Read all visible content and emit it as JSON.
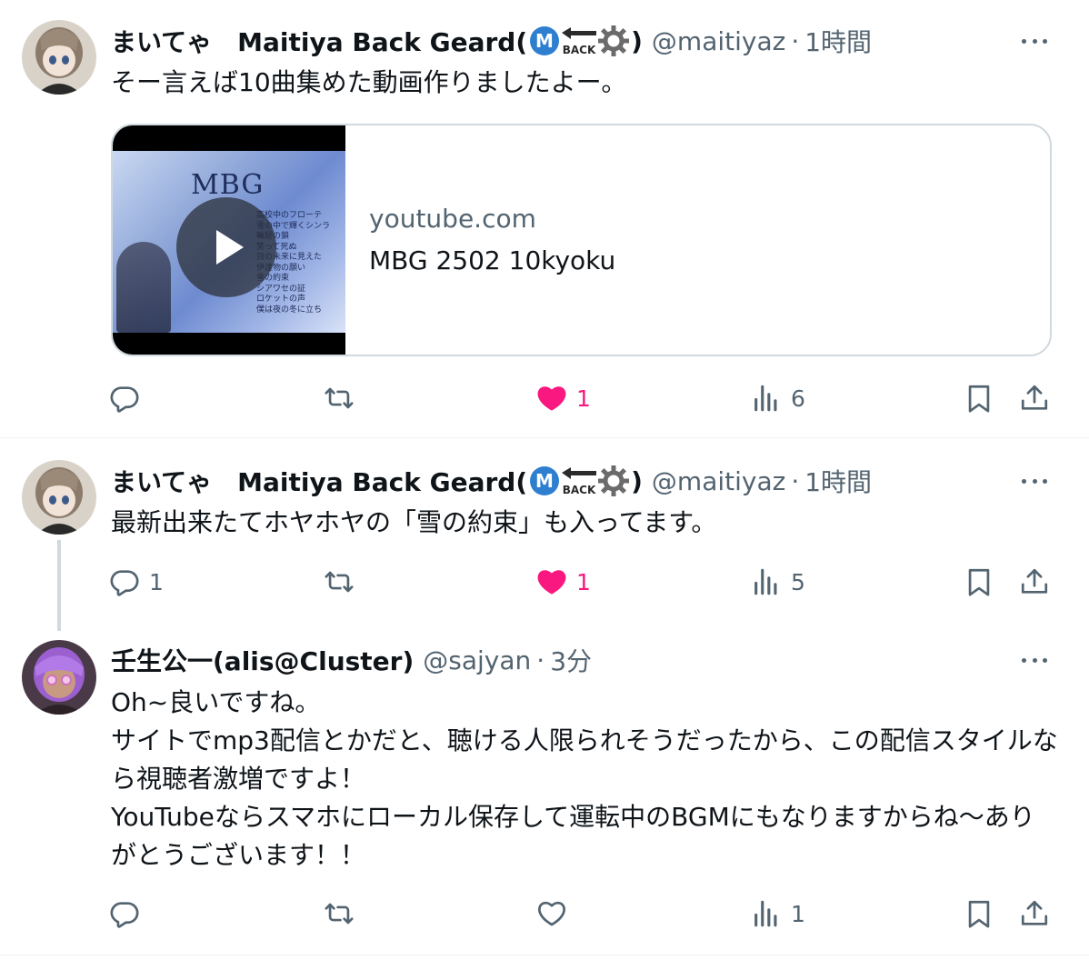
{
  "tweets": [
    {
      "display_name": "まいてゃ　Maitiya Back Geard(",
      "display_name_end": ")",
      "badge_letter": "M",
      "badge_back": "BACK",
      "handle": "@maitiyaz",
      "dot": "·",
      "time": "1時間",
      "text": "そー言えば10曲集めた動画作りましたよー。",
      "card": {
        "domain": "youtube.com",
        "title": "MBG 2502 10kyoku",
        "thumb_title": "MBG",
        "thumb_lines": [
          "高校中のフローテ",
          "雪の中で輝くシンラ",
          "輪廻の鎖",
          "笑って死ぬ",
          "目の未来に見えた",
          "伊達物の願い",
          "雪の約束",
          "シアワセの証",
          "ロケットの声",
          "僕は夜の冬に立ち"
        ]
      },
      "stats": {
        "replies": "",
        "reposts": "",
        "likes": "1",
        "views": "6"
      }
    },
    {
      "display_name": "まいてゃ　Maitiya Back Geard(",
      "display_name_end": ")",
      "badge_letter": "M",
      "badge_back": "BACK",
      "handle": "@maitiyaz",
      "dot": "·",
      "time": "1時間",
      "text": "最新出来たてホヤホヤの「雪の約束」も入ってます。",
      "stats": {
        "replies": "1",
        "reposts": "",
        "likes": "1",
        "views": "5"
      }
    },
    {
      "display_name": "壬生公一(alis@Cluster)",
      "handle": "@sajyan",
      "dot": "·",
      "time": "3分",
      "text_lines": [
        "Oh~良いですね。",
        "サイトでmp3配信とかだと、聴ける人限られそうだったから、この配信スタイルな",
        "ら視聴者激増ですよ！",
        "YouTubeならスマホにローカル保存して運転中のBGMにもなりますからね〜あり",
        "がとうございます！！"
      ],
      "stats": {
        "replies": "",
        "reposts": "",
        "likes": "",
        "views": "1"
      }
    }
  ],
  "colors": {
    "text": "#0f1419",
    "secondary": "#536471",
    "like": "#f91880",
    "border": "#cfd9de"
  },
  "icons": [
    "reply-icon",
    "repost-icon",
    "like-icon",
    "views-icon",
    "bookmark-icon",
    "share-icon",
    "more-icon",
    "play-icon"
  ]
}
